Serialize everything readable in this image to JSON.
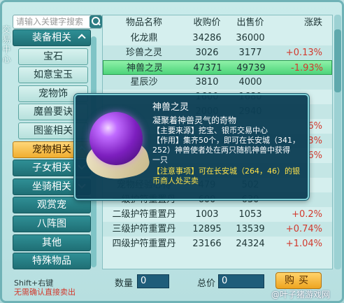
{
  "sidebar": {
    "vertical_caption": "交易中心",
    "search_placeholder": "请输入关键字搜索",
    "categories": [
      {
        "label": "装备相关",
        "type": "header",
        "chevron": "up"
      },
      {
        "label": "宝石",
        "type": "sub"
      },
      {
        "label": "如意宝玉",
        "type": "sub"
      },
      {
        "label": "宠物饰",
        "type": "sub"
      },
      {
        "label": "魔兽要诀",
        "type": "sub"
      },
      {
        "label": "图鉴相关",
        "type": "sub"
      },
      {
        "label": "宠物相关",
        "type": "active",
        "chevron": "up"
      },
      {
        "label": "子女相关",
        "type": "header",
        "chevron": "down"
      },
      {
        "label": "坐骑相关",
        "type": "header",
        "chevron": "down"
      },
      {
        "label": "观赏宠",
        "type": "header"
      },
      {
        "label": "八阵图",
        "type": "header"
      },
      {
        "label": "其他",
        "type": "header"
      },
      {
        "label": "特殊物品",
        "type": "header"
      }
    ],
    "hint_line1": "Shift+右键",
    "hint_line2": "无需确认直接卖出"
  },
  "table": {
    "headers": [
      "物品名称",
      "收购价",
      "出售价",
      "涨跌"
    ],
    "rows": [
      {
        "name": "化龙鼎",
        "buy": "34286",
        "sell": "36000",
        "change": "",
        "dir": ""
      },
      {
        "name": "珍兽之灵",
        "buy": "3026",
        "sell": "3177",
        "change": "+0.13%",
        "dir": "up"
      },
      {
        "name": "神兽之灵",
        "buy": "47371",
        "sell": "49739",
        "change": "-1.93%",
        "dir": "down",
        "selected": true
      },
      {
        "name": "星辰沙",
        "buy": "3810",
        "sell": "4000",
        "change": "",
        "dir": ""
      },
      {
        "name": "",
        "buy": "1600",
        "sell": "1680",
        "change": "",
        "dir": ""
      },
      {
        "name": "",
        "buy": "2000",
        "sell": "2940",
        "change": "",
        "dir": ""
      },
      {
        "name": "",
        "buy": "",
        "sell": "",
        "change": "6%",
        "dir": "up"
      },
      {
        "name": "",
        "buy": "",
        "sell": "",
        "change": "3%",
        "dir": "up"
      },
      {
        "name": "",
        "buy": "",
        "sell": "",
        "change": "6%",
        "dir": "up"
      },
      {
        "name": "",
        "buy": "",
        "sell": "",
        "change": "",
        "dir": ""
      },
      {
        "name": "宠物经验心得",
        "buy": "479",
        "sell": "502",
        "change": "",
        "dir": ""
      },
      {
        "name": "一级护符重置丹",
        "buy": "600",
        "sell": "630",
        "change": "",
        "dir": ""
      },
      {
        "name": "二级护符重置丹",
        "buy": "1003",
        "sell": "1053",
        "change": "+0.2%",
        "dir": "up"
      },
      {
        "name": "三级护符重置丹",
        "buy": "12895",
        "sell": "13539",
        "change": "+0.74%",
        "dir": "up"
      },
      {
        "name": "四级护符重置丹",
        "buy": "23166",
        "sell": "24324",
        "change": "+1.04%",
        "dir": "up"
      }
    ]
  },
  "tooltip": {
    "title": "神兽之灵",
    "subtitle": "凝聚着神兽灵气的奇物",
    "source": "【主要来源】挖宝、银币交易中心",
    "effect_1": "【作用】集齐50个，即可在长安城（341，",
    "effect_2": "252）神兽使者处在两只随机神兽中获得",
    "effect_3": "一只",
    "note_1": "【注意事项】可在长安城（264，46）的银",
    "note_2": "币商人处买卖"
  },
  "bottom": {
    "qty_label": "数量",
    "qty_value": "0",
    "total_label": "总价",
    "total_value": "0",
    "buy_label": "购买"
  },
  "watermark": "@叶子猪游戏网"
}
